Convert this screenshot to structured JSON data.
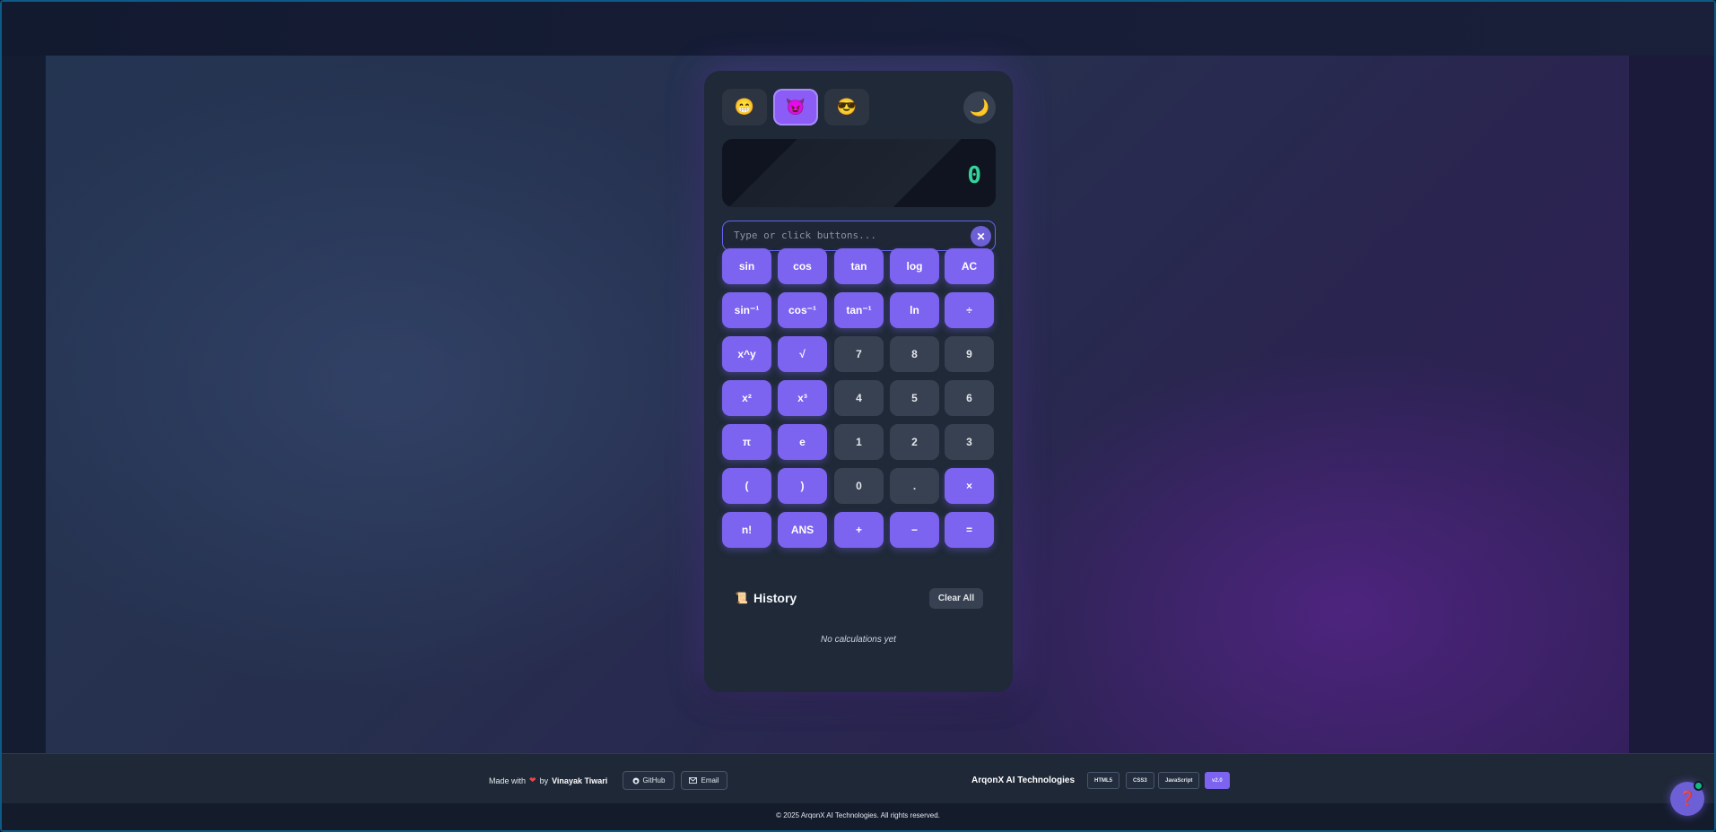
{
  "themes": [
    {
      "icon": "grinning-face-icon",
      "glyph": "😁"
    },
    {
      "icon": "smiling-devil-icon",
      "glyph": "😈"
    },
    {
      "icon": "cool-face-icon",
      "glyph": "😎"
    }
  ],
  "theme_toggle_glyph": "🌙",
  "display": {
    "value": "0"
  },
  "input": {
    "placeholder": "Type or click buttons...",
    "clear_glyph": "✕"
  },
  "keys": [
    [
      "sin",
      "cos",
      "tan",
      "log",
      "AC"
    ],
    [
      "sin⁻¹",
      "cos⁻¹",
      "tan⁻¹",
      "ln",
      "÷"
    ],
    [
      "x^y",
      "√",
      "7",
      "8",
      "9"
    ],
    [
      "x²",
      "x³",
      "4",
      "5",
      "6"
    ],
    [
      "π",
      "e",
      "1",
      "2",
      "3"
    ],
    [
      "(",
      ")",
      "0",
      ".",
      "×"
    ],
    [
      "n!",
      "ANS",
      "+",
      "−",
      "="
    ]
  ],
  "history": {
    "title": "History",
    "icon_glyph": "📜",
    "clear_label": "Clear All",
    "empty_text": "No calculations yet"
  },
  "footer": {
    "made_with": "Made with",
    "heart": "❤",
    "by": "by",
    "author": "Vinayak Tiwari",
    "github_label": "GitHub",
    "email_label": "Email",
    "brand": "ArqonX AI Technologies",
    "badges": [
      "HTML5",
      "CSS3",
      "JavaScript"
    ],
    "version": "v2.0",
    "copyright": "© 2025 ArqonX AI Technologies. All rights reserved."
  },
  "help_glyph": "❓",
  "colors": {
    "accent": "#7c63f0",
    "display_text": "#34d399",
    "card": "#1f2937"
  }
}
